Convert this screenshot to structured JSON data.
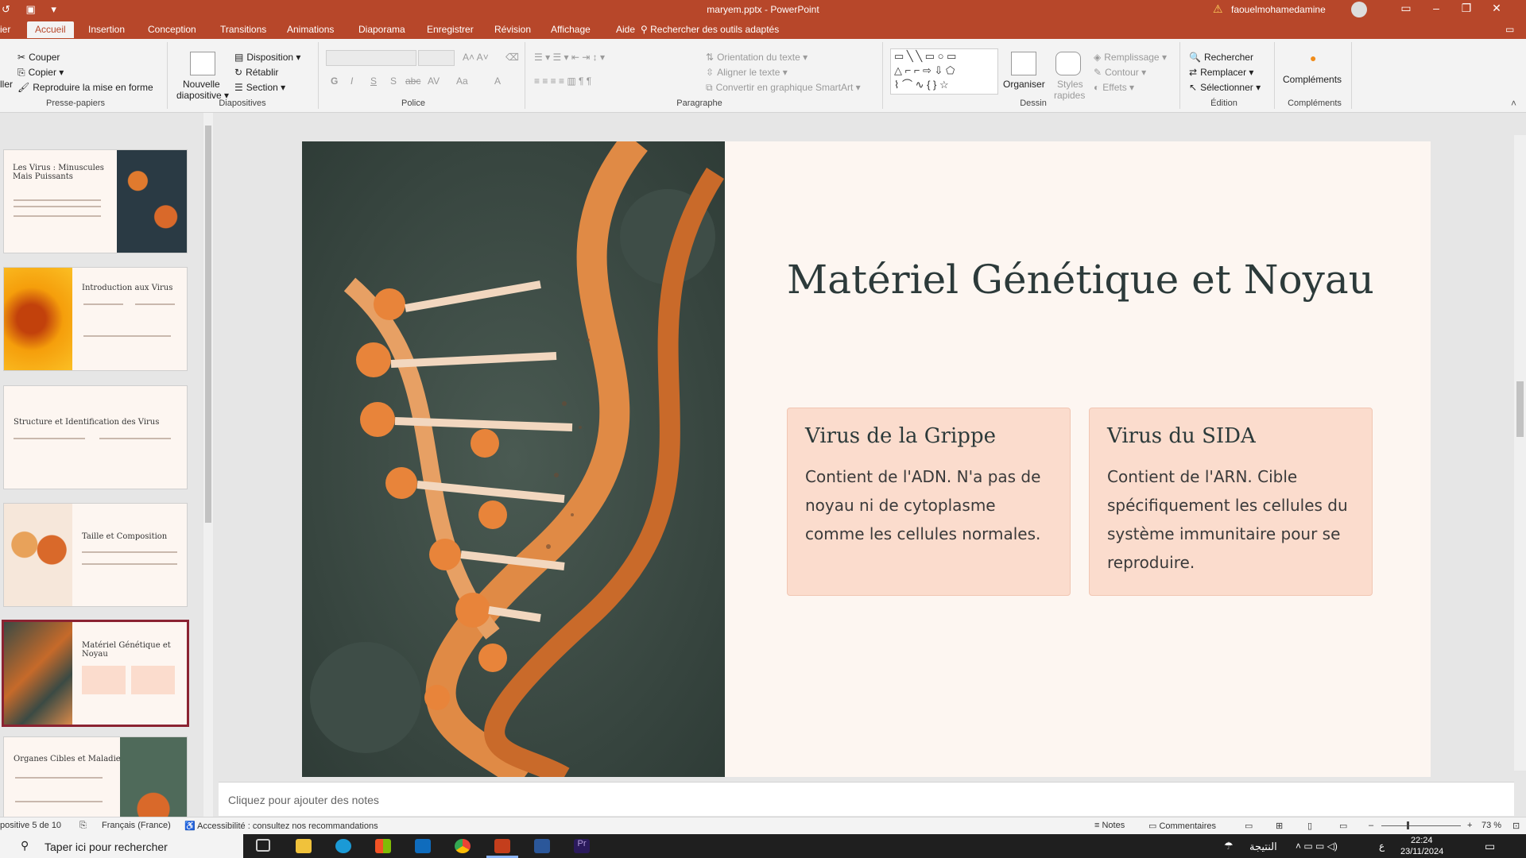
{
  "app": {
    "window_title": "maryem.pptx - PowerPoint",
    "user": "faouelmohamedamine"
  },
  "tabs": [
    "ier",
    "Accueil",
    "Insertion",
    "Conception",
    "Transitions",
    "Animations",
    "Diaporama",
    "Enregistrer",
    "Révision",
    "Affichage",
    "Aide"
  ],
  "tell_me": "Rechercher des outils adaptés",
  "ribbon": {
    "clipboard": {
      "cut": "Couper",
      "copy": "Copier",
      "format_painter": "Reproduire la mise en forme",
      "paste_partial": "ller",
      "label": "Presse-papiers"
    },
    "slides": {
      "new_slide_1": "Nouvelle",
      "new_slide_2": "diapositive",
      "layout": "Disposition",
      "reset": "Rétablir",
      "section": "Section",
      "label": "Diapositives"
    },
    "font": {
      "label": "Police",
      "bold": "G",
      "italic": "I",
      "underline": "S",
      "shadow": "S",
      "strike": "abc",
      "spacing": "AV",
      "case": "Aa",
      "color": "A"
    },
    "paragraph": {
      "label": "Paragraphe",
      "text_direction": "Orientation du texte",
      "align_text": "Aligner le texte",
      "smartart": "Convertir en graphique SmartArt"
    },
    "drawing": {
      "arrange": "Organiser",
      "quick_styles_1": "Styles",
      "quick_styles_2": "rapides",
      "fill": "Remplissage",
      "outline": "Contour",
      "effects": "Effets",
      "label": "Dessin"
    },
    "editing": {
      "find": "Rechercher",
      "replace": "Remplacer",
      "select": "Sélectionner",
      "label": "Édition"
    },
    "addins": {
      "addins": "Compléments",
      "label": "Compléments"
    }
  },
  "thumbnails": [
    {
      "title": "Les Virus : Minuscules Mais Puissants"
    },
    {
      "title": "Introduction aux Virus"
    },
    {
      "title": "Structure et Identification des Virus"
    },
    {
      "title": "Taille et Composition"
    },
    {
      "title": "Matériel Génétique et Noyau"
    },
    {
      "title": "Organes Cibles et Maladies"
    }
  ],
  "slide": {
    "title": "Matériel Génétique et Noyau",
    "cards": [
      {
        "title": "Virus de la Grippe",
        "body": "Contient de l'ADN. N'a pas de noyau ni de cytoplasme comme les cellules normales."
      },
      {
        "title": "Virus du SIDA",
        "body": "Contient de l'ARN. Cible spécifiquement les cellules du système immunitaire pour se reproduire."
      }
    ]
  },
  "notes_placeholder": "Cliquez pour ajouter des notes",
  "status": {
    "slide_pos": "positive 5 de 10",
    "language": "Français (France)",
    "accessibility": "Accessibilité : consultez nos recommandations",
    "notes": "Notes",
    "comments": "Commentaires",
    "zoom": "73 %"
  },
  "taskbar": {
    "search": "Taper ici pour rechercher",
    "arabic": "النتيجة",
    "time": "22:24",
    "date": "23/11/2024",
    "lang": "ع"
  },
  "colors": {
    "accent": "#b7472a",
    "slide_bg": "#fdf6f1",
    "card_bg": "#fbdccd",
    "selected_thumb": "#8b2332"
  }
}
